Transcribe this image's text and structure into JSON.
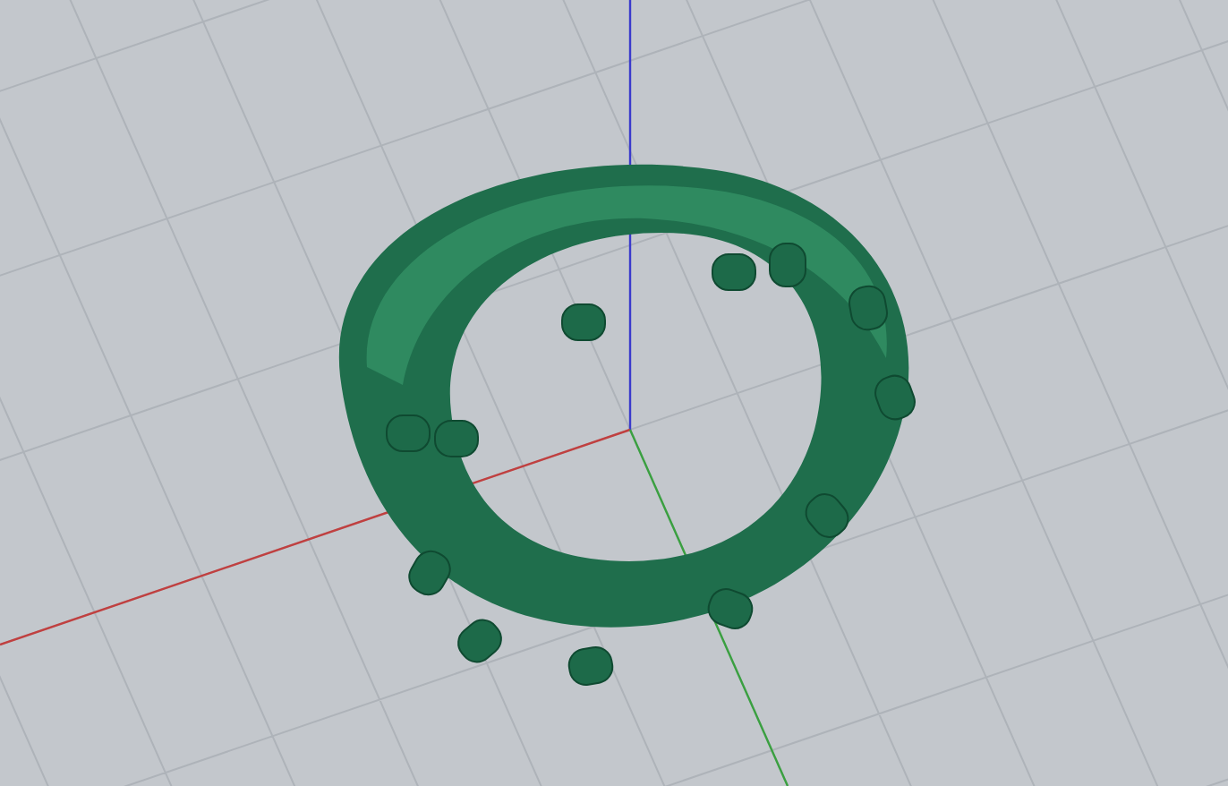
{
  "viewport": {
    "grid": true,
    "axes": true,
    "model": {
      "kind": "ring"
    }
  }
}
